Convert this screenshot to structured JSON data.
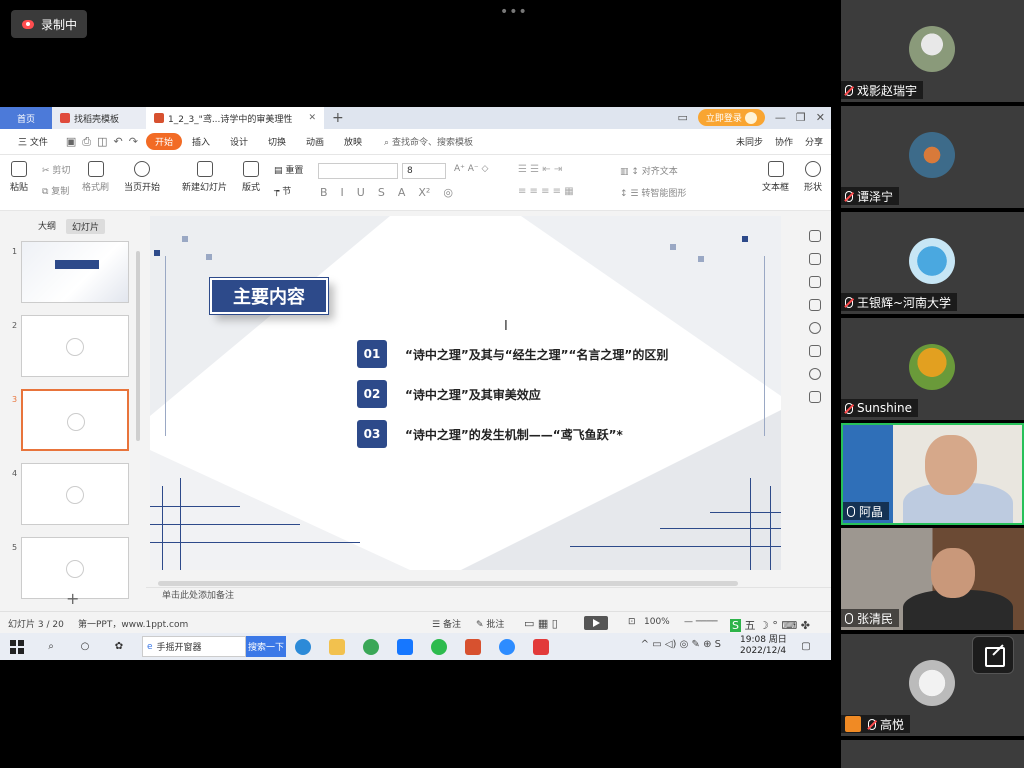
{
  "recording": {
    "label": "录制中"
  },
  "window": {
    "tabs": [
      {
        "label": "首页"
      },
      {
        "label": "找稻壳模板"
      },
      {
        "label": "1_2_3_\"鸢...诗学中的审美理性"
      }
    ],
    "login_label": "立即登录"
  },
  "menu": {
    "file": "三 文件",
    "items": [
      "开始",
      "插入",
      "设计",
      "切换",
      "动画",
      "放映"
    ],
    "search": "查找命令、搜索模板",
    "right": [
      "未同步",
      "协作",
      "分享"
    ]
  },
  "ribbon": {
    "paste": "粘贴",
    "cut": "剪切",
    "copy": "复制",
    "format_painter": "格式刷",
    "start_from_current": "当页开始",
    "new_slide": "新建幻灯片",
    "layout": "版式",
    "reset": "重置",
    "section": "节",
    "font_size": "8",
    "align_text": "对齐文本",
    "to_smartart": "转智能图形",
    "textbox": "文本框",
    "shape": "形状"
  },
  "leftpane": {
    "tabs": [
      "大纲",
      "幻灯片"
    ],
    "slide_numbers": [
      "1",
      "2",
      "3",
      "4",
      "5"
    ],
    "add": "+"
  },
  "slide": {
    "title": "主要内容",
    "items": [
      {
        "num": "01",
        "text": "“诗中之理”及其与“经生之理”“名言之理”的区别"
      },
      {
        "num": "02",
        "text": "“诗中之理”及其审美效应"
      },
      {
        "num": "03",
        "text": "“诗中之理”的发生机制——“鸢飞鱼跃”*"
      }
    ]
  },
  "notes_placeholder": "单击此处添加备注",
  "status": {
    "slide_pos": "幻灯片 3 / 20",
    "theme": "第一PPT，www.1ppt.com",
    "notes": "备注",
    "comments": "批注",
    "zoom": "100%"
  },
  "taskbar": {
    "browser_label": "手摇开窗器",
    "search_button": "搜索一下",
    "time": "19:08 周日",
    "date": "2022/12/4",
    "ime": "五"
  },
  "participants": [
    {
      "name": "戏影赵瑞宇"
    },
    {
      "name": "谭泽宁"
    },
    {
      "name": "王银辉~河南大学"
    },
    {
      "name": "Sunshine"
    },
    {
      "name": "阿晶"
    },
    {
      "name": "张清民"
    },
    {
      "name": "高悦"
    }
  ]
}
